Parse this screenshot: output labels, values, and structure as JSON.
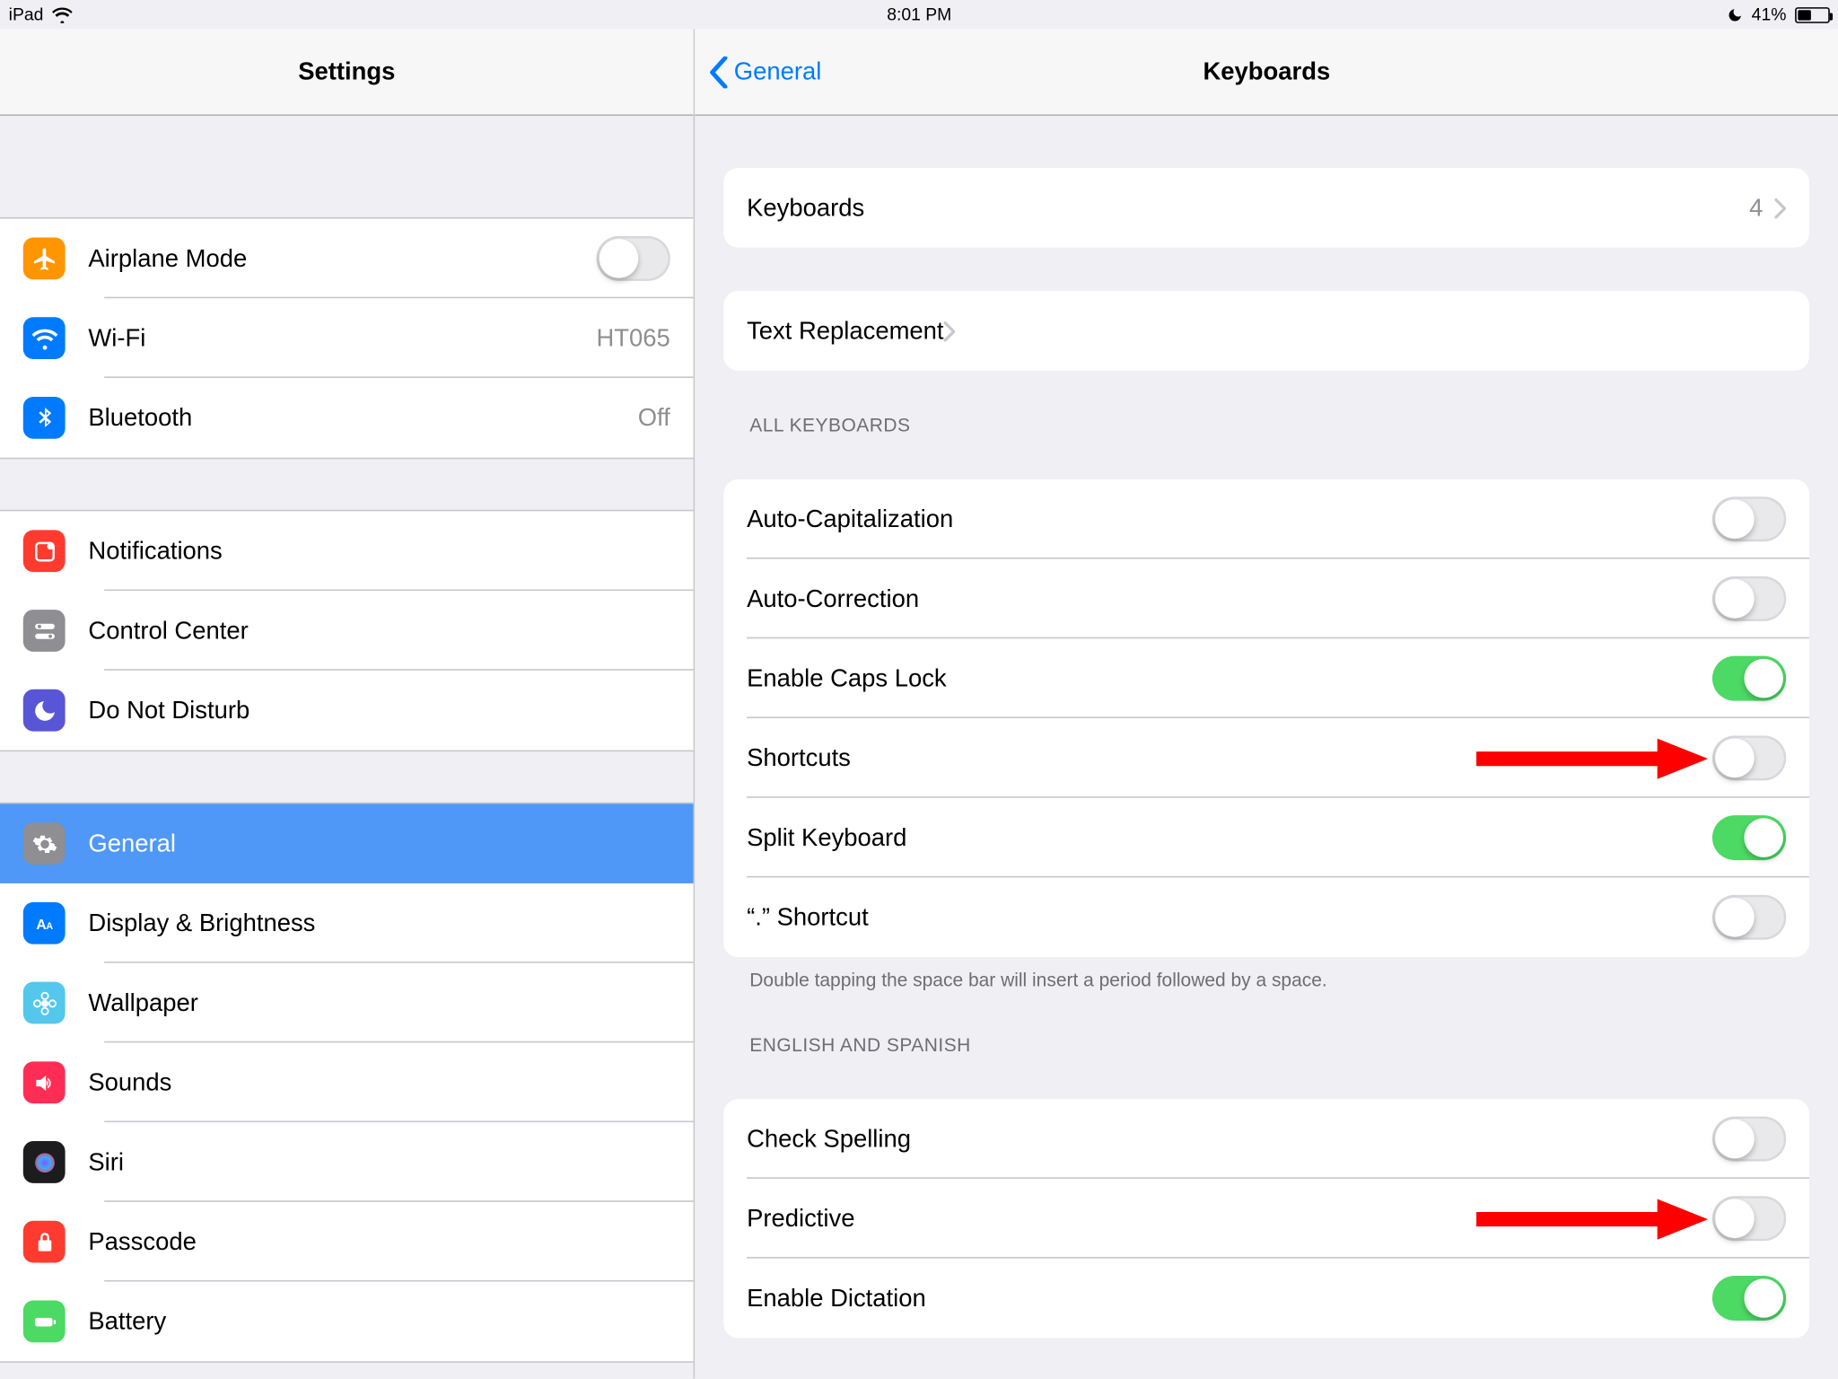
{
  "status": {
    "device": "iPad",
    "time": "8:01 PM",
    "battery_pct": "41%",
    "battery_fill_pct": 41
  },
  "sidebar": {
    "title": "Settings",
    "groups": [
      {
        "id": "connectivity",
        "items": [
          {
            "id": "airplane",
            "label": "Airplane Mode",
            "icon": "airplane",
            "color": "bg-orange",
            "toggle": false
          },
          {
            "id": "wifi",
            "label": "Wi-Fi",
            "icon": "wifi",
            "color": "bg-blue",
            "value": "HT065"
          },
          {
            "id": "bluetooth",
            "label": "Bluetooth",
            "icon": "bluetooth",
            "color": "bg-blue",
            "value": "Off"
          }
        ]
      },
      {
        "id": "notify",
        "items": [
          {
            "id": "notifications",
            "label": "Notifications",
            "icon": "bell-square",
            "color": "bg-red"
          },
          {
            "id": "controlcenter",
            "label": "Control Center",
            "icon": "toggles",
            "color": "bg-gray"
          },
          {
            "id": "dnd",
            "label": "Do Not Disturb",
            "icon": "moon",
            "color": "bg-indigo"
          }
        ]
      },
      {
        "id": "general",
        "items": [
          {
            "id": "general",
            "label": "General",
            "icon": "gear",
            "color": "bg-graysel",
            "selected": true
          },
          {
            "id": "display",
            "label": "Display & Brightness",
            "icon": "aa",
            "color": "bg-blue"
          },
          {
            "id": "wallpaper",
            "label": "Wallpaper",
            "icon": "flower",
            "color": "bg-cyan"
          },
          {
            "id": "sounds",
            "label": "Sounds",
            "icon": "speaker",
            "color": "bg-pink"
          },
          {
            "id": "siri",
            "label": "Siri",
            "icon": "siri",
            "color": "bg-black"
          },
          {
            "id": "passcode",
            "label": "Passcode",
            "icon": "lock",
            "color": "bg-red"
          },
          {
            "id": "battery",
            "label": "Battery",
            "icon": "battery",
            "color": "bg-green"
          }
        ]
      }
    ]
  },
  "detail": {
    "back_label": "General",
    "title": "Keyboards",
    "groups": [
      {
        "id": "keyboards",
        "rows": [
          {
            "id": "keyboards-count",
            "label": "Keyboards",
            "value": "4",
            "chevron": true
          }
        ]
      },
      {
        "id": "textreplace",
        "rows": [
          {
            "id": "text-replacement",
            "label": "Text Replacement",
            "chevron": true
          }
        ]
      }
    ],
    "sections": [
      {
        "header": "ALL KEYBOARDS",
        "footer": "Double tapping the space bar will insert a period followed by a space.",
        "rows": [
          {
            "id": "autocap",
            "label": "Auto-Capitalization",
            "on": false
          },
          {
            "id": "autocorr",
            "label": "Auto-Correction",
            "on": false
          },
          {
            "id": "capslock",
            "label": "Enable Caps Lock",
            "on": true
          },
          {
            "id": "shortcuts",
            "label": "Shortcuts",
            "on": false,
            "arrow": true
          },
          {
            "id": "splitkb",
            "label": "Split Keyboard",
            "on": true
          },
          {
            "id": "dotshort",
            "label": "“.” Shortcut",
            "on": false
          }
        ]
      },
      {
        "header": "ENGLISH AND SPANISH",
        "rows": [
          {
            "id": "spelling",
            "label": "Check Spelling",
            "on": false
          },
          {
            "id": "predictive",
            "label": "Predictive",
            "on": false,
            "arrow": true
          },
          {
            "id": "dictation",
            "label": "Enable Dictation",
            "on": true
          }
        ]
      }
    ]
  }
}
